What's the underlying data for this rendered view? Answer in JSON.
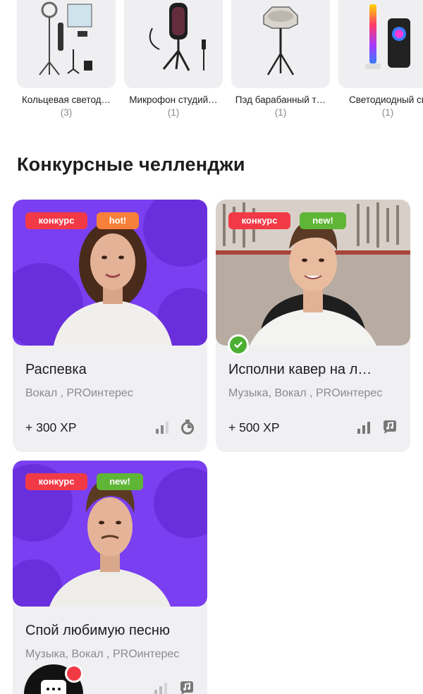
{
  "products": [
    {
      "name": "Кольцевая светод…",
      "count": "(3)",
      "icon": "ring-light-kit-image"
    },
    {
      "name": "Микрофон студий…",
      "count": "(1)",
      "icon": "studio-microphone-image"
    },
    {
      "name": "Пэд барабанный т…",
      "count": "(1)",
      "icon": "drum-pad-image"
    },
    {
      "name": "Светодиодный св",
      "count": "(1)",
      "icon": "led-lamp-image"
    }
  ],
  "section_title": "Конкурсные челленджи",
  "challenges": [
    {
      "title": "Распевка",
      "tags": "Вокал , PROинтерес",
      "xp": "+ 300 XP",
      "badge_main": "конкурс",
      "badge_extra": "hot!",
      "completed": false,
      "bg_color": "#7a3ff0",
      "icons": [
        "difficulty-bars-icon",
        "stopwatch-icon"
      ]
    },
    {
      "title": "Исполни кавер на л…",
      "tags": "Музыка, Вокал , PROинтерес",
      "xp": "+ 500 XP",
      "badge_main": "конкурс",
      "badge_extra": "new!",
      "completed": true,
      "bg_color": "#9a8f86",
      "icons": [
        "difficulty-bars-icon",
        "speech-note-icon"
      ]
    },
    {
      "title": "Спой любимую песню",
      "tags": "Музыка, Вокал , PROинтерес",
      "xp": "",
      "badge_main": "конкурс",
      "badge_extra": "new!",
      "completed": false,
      "bg_color": "#7a3ff0",
      "icons": [
        "difficulty-bars-icon",
        "speech-note-icon"
      ]
    }
  ],
  "colors": {
    "contest": "#f23a47",
    "hot": "#f6803a",
    "new": "#5fb536",
    "purple": "#7a3ff0",
    "card_bg": "#f0f0f3"
  },
  "chat_button": {
    "icon": "chat-icon"
  }
}
